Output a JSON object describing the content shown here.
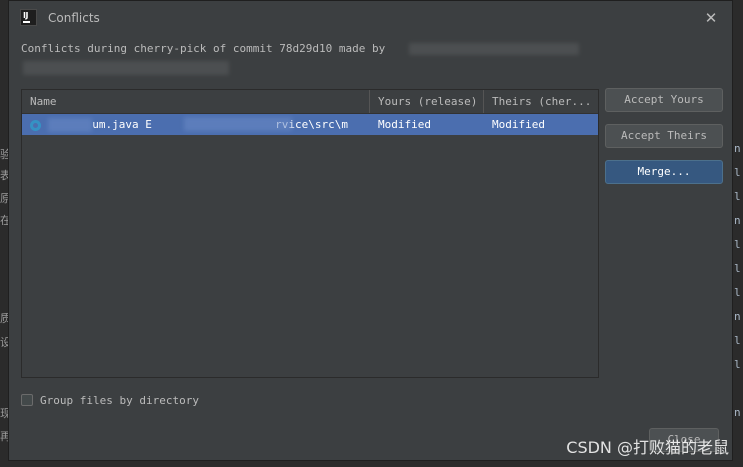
{
  "dialog": {
    "title": "Conflicts",
    "description_prefix": "Conflicts during cherry-pick of commit 78d29d10 made by"
  },
  "table": {
    "headers": [
      "Name",
      "Yours (release)",
      "Theirs (cher..."
    ],
    "rows": [
      {
        "name": "um.java E",
        "path": "rvice\\src\\m",
        "yours": "Modified",
        "theirs": "Modified"
      }
    ]
  },
  "buttons": {
    "accept_yours": "Accept Yours",
    "accept_theirs": "Accept Theirs",
    "merge": "Merge...",
    "close": "Close"
  },
  "options": {
    "group_by_directory": "Group files by directory",
    "group_by_directory_checked": false
  },
  "watermark": "CSDN @打败猫的老鼠",
  "colors": {
    "dialog_bg": "#3c3f41",
    "selection": "#4b6eaf",
    "primary_button": "#365880"
  }
}
